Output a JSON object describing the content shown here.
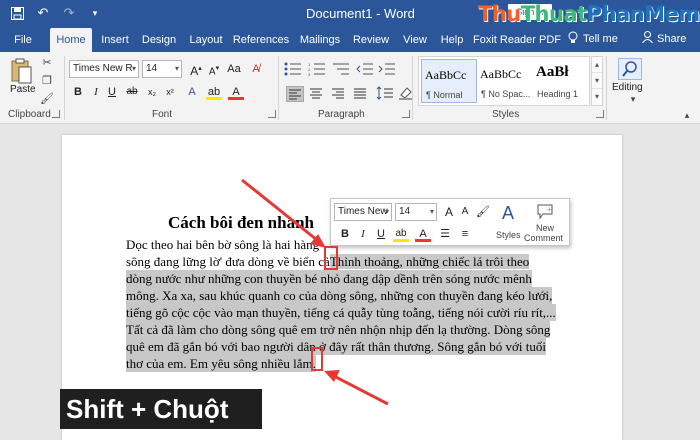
{
  "window": {
    "title": "Document1 - Word",
    "signin_label": "Sign in",
    "watermark": {
      "part1": "Thu",
      "part2": "Thuat",
      "part3": "PhanMem.vn"
    }
  },
  "tabs": [
    {
      "label": "File"
    },
    {
      "label": "Home",
      "active": true
    },
    {
      "label": "Insert"
    },
    {
      "label": "Design"
    },
    {
      "label": "Layout"
    },
    {
      "label": "References"
    },
    {
      "label": "Mailings"
    },
    {
      "label": "Review"
    },
    {
      "label": "View"
    },
    {
      "label": "Help"
    },
    {
      "label": "Foxit Reader PDF"
    }
  ],
  "tell_me": "Tell me",
  "share": "Share",
  "ribbon": {
    "clipboard": {
      "paste_label": "Paste",
      "group_label": "Clipboard"
    },
    "font": {
      "font_name": "Times New R",
      "font_size": "14",
      "group_label": "Font"
    },
    "paragraph": {
      "group_label": "Paragraph"
    },
    "styles": {
      "group_label": "Styles",
      "items": [
        {
          "sample": "AaBbCc",
          "name": "¶ Normal"
        },
        {
          "sample": "AaBbCc",
          "name": "¶ No Spac..."
        },
        {
          "sample": "AaBł",
          "name": "Heading 1"
        }
      ]
    },
    "editing": {
      "label": "Editing"
    }
  },
  "document": {
    "heading": "Cách bôi đen nhanh",
    "lines": [
      {
        "text": "Dọc theo hai bên bờ sông là hai hàng",
        "tail": ""
      },
      {
        "text": "sông đang lững lờ' đưa dòng về biển cả",
        "tail": "Thỉnh thoảng, những chiếc lá trôi theo"
      },
      {
        "text": "",
        "tail": "dòng nước như những con thuyền bé nhỏ đang dập dềnh trên sóng nước mênh"
      },
      {
        "text": "",
        "tail": "mông. Xa xa, sau khúc quanh co của dòng sông, những con thuyền đang kéo lưới,"
      },
      {
        "text": "",
        "tail": "tiếng gõ cộc cộc vào mạn thuyền, tiếng cá quẫy tùng toẵng, tiếng nói cười ríu rít,..."
      },
      {
        "text": "",
        "tail": "Tất cả đã làm cho dòng sông quê em trở nên nhộn nhịp đến lạ thường. Dòng sông"
      },
      {
        "text": "",
        "tail": "quê em đã gắn bó với bao người dân ở đây rất thân thương. Sông gắn bó với tuổi"
      },
      {
        "text": "",
        "tail": "thơ của em. Em yêu sông nhiều lắm."
      }
    ]
  },
  "mini_toolbar": {
    "font_name": "Times New",
    "font_size": "14",
    "styles_label": "Styles",
    "new_comment_line1": "New",
    "new_comment_line2": "Comment"
  },
  "caption": "Shift + Chuột",
  "accent_color": "#2b579a",
  "annotation_color": "#e53935"
}
